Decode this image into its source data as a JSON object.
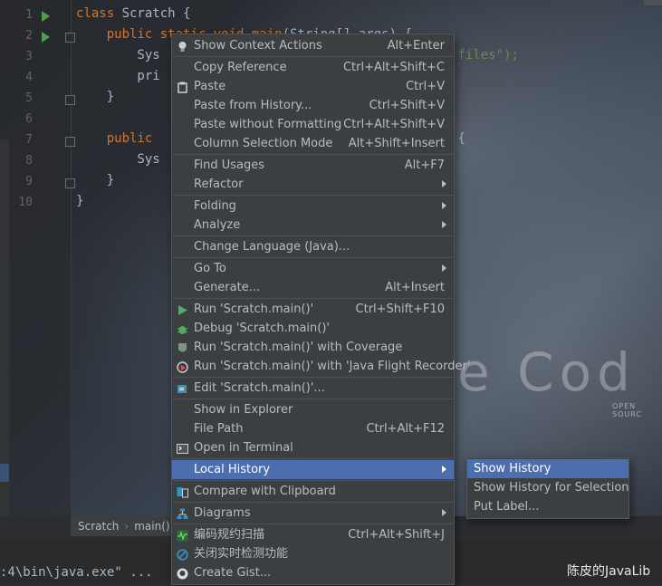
{
  "editor": {
    "line_numbers": [
      "1",
      "2",
      "3",
      "4",
      "5",
      "6",
      "7",
      "8",
      "9",
      "10"
    ],
    "lines": [
      {
        "parts": [
          {
            "t": "class ",
            "c": "kw"
          },
          {
            "t": "Scratch {",
            "c": ""
          }
        ]
      },
      {
        "parts": [
          {
            "t": "    public static void main",
            "c": "kw"
          },
          {
            "t": "(String[] args) {",
            "c": ""
          }
        ]
      },
      {
        "parts": [
          {
            "t": "        Sys",
            "c": ""
          },
          {
            "t": "                                     s files\");",
            "c": "str"
          }
        ]
      },
      {
        "parts": [
          {
            "t": "        pri",
            "c": ""
          }
        ]
      },
      {
        "parts": [
          {
            "t": "    }",
            "c": ""
          }
        ]
      },
      {
        "parts": [
          {
            "t": "",
            "c": ""
          }
        ]
      },
      {
        "parts": [
          {
            "t": "    public ",
            "c": "kw"
          },
          {
            "t": "                                    e) {",
            "c": ""
          }
        ]
      },
      {
        "parts": [
          {
            "t": "        Sys",
            "c": ""
          }
        ]
      },
      {
        "parts": [
          {
            "t": "    }",
            "c": ""
          }
        ]
      },
      {
        "parts": [
          {
            "t": "}",
            "c": ""
          }
        ]
      }
    ],
    "watermark": "e Cod",
    "watermark_sub": "OPEN SOURC"
  },
  "breadcrumb": {
    "items": [
      "Scratch",
      "main()"
    ]
  },
  "run_panel": {
    "path_text": ":4\\bin\\java.exe\" ...",
    "credit": "陈皮的JavaLib"
  },
  "menu": {
    "items": [
      {
        "label": "Show Context Actions",
        "shortcut": "Alt+Enter",
        "icon": "bulb-icon"
      },
      {
        "sep": true
      },
      {
        "label": "Copy Reference",
        "shortcut": "Ctrl+Alt+Shift+C"
      },
      {
        "label": "Paste",
        "shortcut": "Ctrl+V",
        "icon": "paste-icon"
      },
      {
        "label": "Paste from History...",
        "shortcut": "Ctrl+Shift+V"
      },
      {
        "label": "Paste without Formatting",
        "shortcut": "Ctrl+Alt+Shift+V"
      },
      {
        "label": "Column Selection Mode",
        "shortcut": "Alt+Shift+Insert"
      },
      {
        "sep": true
      },
      {
        "label": "Find Usages",
        "shortcut": "Alt+F7"
      },
      {
        "label": "Refactor",
        "submenu": true
      },
      {
        "sep": true
      },
      {
        "label": "Folding",
        "submenu": true
      },
      {
        "label": "Analyze",
        "submenu": true
      },
      {
        "sep": true
      },
      {
        "label": "Change Language (Java)..."
      },
      {
        "sep": true
      },
      {
        "label": "Go To",
        "submenu": true
      },
      {
        "label": "Generate...",
        "shortcut": "Alt+Insert"
      },
      {
        "sep": true
      },
      {
        "label": "Run 'Scratch.main()'",
        "shortcut": "Ctrl+Shift+F10",
        "icon": "run-icon"
      },
      {
        "label": "Debug 'Scratch.main()'",
        "icon": "debug-icon"
      },
      {
        "label": "Run 'Scratch.main()' with Coverage",
        "icon": "coverage-icon"
      },
      {
        "label": "Run 'Scratch.main()' with 'Java Flight Recorder'",
        "icon": "profiler-icon"
      },
      {
        "sep": true
      },
      {
        "label": "Edit 'Scratch.main()'...",
        "icon": "edit-config-icon"
      },
      {
        "sep": true
      },
      {
        "label": "Show in Explorer"
      },
      {
        "label": "File Path",
        "shortcut": "Ctrl+Alt+F12"
      },
      {
        "label": "Open in Terminal",
        "icon": "terminal-icon"
      },
      {
        "sep": true
      },
      {
        "label": "Local History",
        "submenu": true,
        "selected": true
      },
      {
        "sep": true
      },
      {
        "label": "Compare with Clipboard",
        "icon": "compare-icon"
      },
      {
        "sep": true
      },
      {
        "label": "Diagrams",
        "submenu": true,
        "icon": "diagram-icon"
      },
      {
        "sep": true
      },
      {
        "label": "编码规约扫描",
        "shortcut": "Ctrl+Alt+Shift+J",
        "icon": "scan-icon"
      },
      {
        "label": "关闭实时检测功能",
        "icon": "disable-icon"
      },
      {
        "label": "Create Gist...",
        "icon": "github-icon"
      }
    ]
  },
  "submenu": {
    "items": [
      {
        "label": "Show History",
        "selected": true
      },
      {
        "label": "Show History for Selection"
      },
      {
        "label": "Put Label..."
      }
    ]
  },
  "colors": {
    "menu_bg": "#3c3f41",
    "selection": "#4b6eaf",
    "keyword": "#cc7832",
    "string": "#6a8759",
    "run_green": "#4c9f50"
  }
}
